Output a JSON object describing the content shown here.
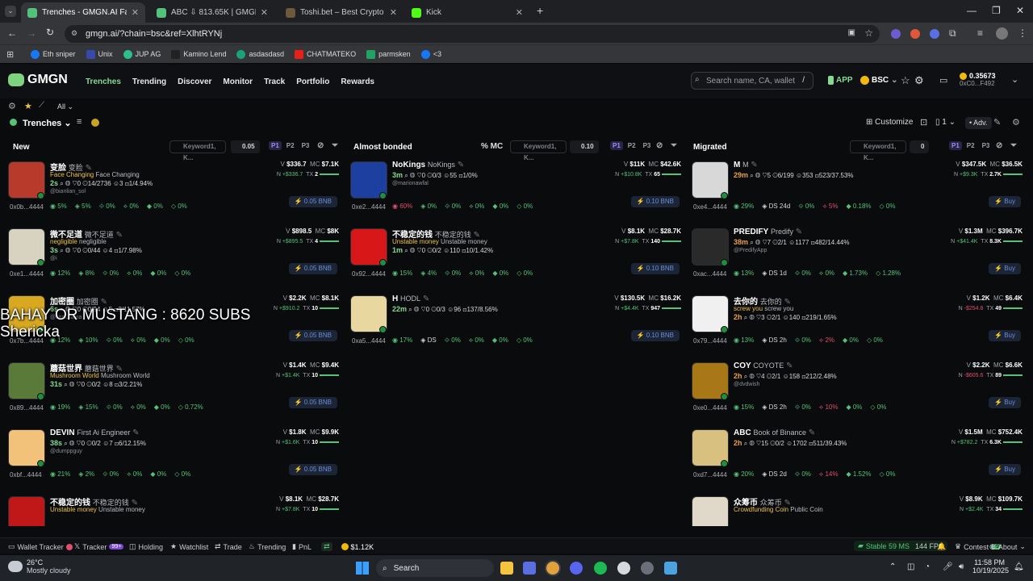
{
  "browser": {
    "tabs": [
      {
        "title": "Trenches - GMGN.AI Fast Trading",
        "active": true
      },
      {
        "title": "ABC ⇩ 813.65K | GMGN.AI Fast",
        "active": false
      },
      {
        "title": "Toshi.bet – Best Crypto Casino",
        "active": false
      },
      {
        "title": "Kick",
        "active": false
      }
    ],
    "url": "gmgn.ai/?chain=bsc&ref=XlhtRYNj",
    "bookmarks": [
      "Eth sniper",
      "Unix",
      "JUP AG",
      "Kamino Lend",
      "asdasdasd",
      "CHATMATEKO",
      "parmsken",
      "<3"
    ]
  },
  "header": {
    "logo": "GMGN",
    "nav": [
      "Trenches",
      "Trending",
      "Discover",
      "Monitor",
      "Track",
      "Portfolio",
      "Rewards"
    ],
    "active_nav": "Trenches",
    "search_placeholder": "Search name, CA, wallet",
    "search_shortcut": "/",
    "app_label": "APP",
    "chain": "BSC",
    "balance": "0.35673",
    "wallet": "0xC0...F492"
  },
  "subbar": {
    "filter": "All",
    "title": "Trenches",
    "customize": "Customize",
    "count": "1",
    "adv": "Adv."
  },
  "columns": [
    {
      "title": "New",
      "keyword": "Keyword1, K...",
      "amount": "0.05",
      "presets": [
        "P1",
        "P2",
        "P3"
      ]
    },
    {
      "title": "Almost bonded",
      "sort": "% MC",
      "keyword": "Keyword1, K...",
      "amount": "0.10",
      "presets": [
        "P1",
        "P2",
        "P3"
      ]
    },
    {
      "title": "Migrated",
      "keyword": "Keyword1, K...",
      "amount": "0",
      "presets": [
        "P1",
        "P2",
        "P3"
      ]
    }
  ],
  "new_tokens": [
    {
      "name": "变脸",
      "sub": "变脸",
      "desc": "Face Changing",
      "desc2": "Face Changing",
      "age": "2s",
      "a": "0",
      "b": "14/2736",
      "c": "3",
      "d": "1/4.94%",
      "handle": "@bianlian_sol",
      "addr": "0x0b...4444",
      "v": "$336.7",
      "mc": "$7.1K",
      "n": "+$336.7",
      "tx": "2",
      "s": [
        "5%",
        "5%",
        "0%",
        "0%",
        "0%",
        "0%"
      ],
      "btn": "0.05 BNB"
    },
    {
      "name": "微不足道",
      "sub": "微不足道",
      "desc": "negligible",
      "desc2": "negligible",
      "age": "3s",
      "a": "0",
      "b": "0/44",
      "c": "4",
      "d": "1/7.98%",
      "handle": "@i",
      "addr": "0xe1...4444",
      "v": "$898.5",
      "mc": "$8K",
      "n": "+$895.5",
      "tx": "4",
      "s": [
        "12%",
        "8%",
        "0%",
        "0%",
        "0%",
        "0%"
      ],
      "btn": "0.05 BNB"
    },
    {
      "name": "加密圈",
      "sub": "加密圈",
      "desc": "",
      "desc2": "",
      "age": "6s",
      "a": "0",
      "b": "0/94",
      "c": "5",
      "d": "3/11.57%",
      "handle": "@JiraLsama",
      "addr": "0x7b...4444",
      "v": "$2.2K",
      "mc": "$8.1K",
      "n": "+$910.2",
      "tx": "10",
      "s": [
        "12%",
        "10%",
        "0%",
        "0%",
        "0%",
        "0%"
      ],
      "btn": "0.05 BNB"
    },
    {
      "name": "蘑菇世界",
      "sub": "蘑菇世界",
      "desc": "Mushroom World",
      "desc2": "Mushroom World",
      "age": "31s",
      "a": "0",
      "b": "0/2",
      "c": "8",
      "d": "3/2.21%",
      "handle": "",
      "addr": "0x89...4444",
      "v": "$1.4K",
      "mc": "$9.4K",
      "n": "+$1.4K",
      "tx": "10",
      "s": [
        "19%",
        "15%",
        "0%",
        "0%",
        "0%",
        "0.72%"
      ],
      "btn": "0.05 BNB"
    },
    {
      "name": "DEVIN",
      "sub": "First Ai Engineer",
      "desc": "",
      "desc2": "",
      "age": "38s",
      "a": "0",
      "b": "0/2",
      "c": "7",
      "d": "6/12.15%",
      "handle": "@dumppguy",
      "addr": "0xbf...4444",
      "v": "$1.8K",
      "mc": "$9.9K",
      "n": "+$1.6K",
      "tx": "10",
      "s": [
        "21%",
        "2%",
        "0%",
        "0%",
        "0%",
        "0%"
      ],
      "btn": "0.05 BNB"
    },
    {
      "name": "不稳定的钱",
      "sub": "不稳定的钱",
      "desc": "Unstable money",
      "desc2": "Unstable money",
      "age": "",
      "a": "",
      "b": "",
      "c": "",
      "d": "",
      "handle": "",
      "addr": "",
      "v": "$8.1K",
      "mc": "$28.7K",
      "n": "+$7.8K",
      "tx": "10",
      "s": [],
      "btn": ""
    }
  ],
  "bonded_tokens": [
    {
      "name": "NoKings",
      "sub": "NoKings",
      "desc": "",
      "desc2": "",
      "age": "3m",
      "a": "0",
      "b": "0/3",
      "c": "55",
      "d": "1/0%",
      "handle": "@marionawfal",
      "addr": "0xe2...4444",
      "v": "$11K",
      "mc": "$42.6K",
      "n": "+$10.8K",
      "tx": "65",
      "s": [
        "60%",
        "0%",
        "0%",
        "0%",
        "0%",
        "0%"
      ],
      "btn": "0.10 BNB"
    },
    {
      "name": "不稳定的钱",
      "sub": "不稳定的钱",
      "desc": "Unstable money",
      "desc2": "Unstable money",
      "age": "1m",
      "a": "0",
      "b": "0/2",
      "c": "110",
      "d": "10/1.42%",
      "handle": "",
      "addr": "0x92...4444",
      "v": "$8.1K",
      "mc": "$28.7K",
      "n": "+$7.8K",
      "tx": "140",
      "s": [
        "15%",
        "4%",
        "0%",
        "0%",
        "0%",
        "0%"
      ],
      "btn": "0.10 BNB"
    },
    {
      "name": "H",
      "sub": "HODL",
      "desc": "",
      "desc2": "",
      "age": "22m",
      "a": "0",
      "b": "0/3",
      "c": "96",
      "d": "137/8.56%",
      "handle": "",
      "addr": "0xa5...4444",
      "v": "$130.5K",
      "mc": "$16.2K",
      "n": "+$4.4K",
      "tx": "947",
      "s": [
        "17%",
        "DS",
        "0%",
        "0%",
        "0%",
        "0%"
      ],
      "btn": "0.10 BNB"
    }
  ],
  "migrated_tokens": [
    {
      "name": "M",
      "sub": "M",
      "desc": "",
      "desc2": "",
      "age": "29m",
      "a": "5",
      "b": "6/199",
      "c": "353",
      "d": "523/37.53%",
      "handle": "",
      "addr": "0xe4...4444",
      "v": "$347.5K",
      "mc": "$36.5K",
      "n": "+$9.3K",
      "tx": "2.7K",
      "s": [
        "29%",
        "DS 24d",
        "0%",
        "5%",
        "0.18%",
        "0%"
      ],
      "btn": "Buy"
    },
    {
      "name": "PREDIFY",
      "sub": "Predify",
      "desc": "",
      "desc2": "",
      "age": "38m",
      "a": "7",
      "b": "2/1",
      "c": "1177",
      "d": "482/14.44%",
      "handle": "@PredifyApp",
      "addr": "0xac...4444",
      "v": "$1.3M",
      "mc": "$396.7K",
      "n": "+$41.4K",
      "tx": "8.3K",
      "s": [
        "13%",
        "DS 1d",
        "0%",
        "0%",
        "1.73%",
        "1.28%"
      ],
      "btn": "Buy"
    },
    {
      "name": "去你的",
      "sub": "去你的",
      "desc": "screw you",
      "desc2": "screw you",
      "age": "2h",
      "a": "3",
      "b": "2/1",
      "c": "140",
      "d": "219/1.65%",
      "handle": "",
      "addr": "0x79...4444",
      "v": "$1.2K",
      "mc": "$6.4K",
      "n": "-$254.8",
      "tx": "49",
      "s": [
        "13%",
        "DS 2h",
        "0%",
        "2%",
        "0%",
        "0%"
      ],
      "btn": "Buy"
    },
    {
      "name": "COY",
      "sub": "COYOTE",
      "desc": "",
      "desc2": "",
      "age": "2h",
      "a": "4",
      "b": "2/1",
      "c": "158",
      "d": "212/2.48%",
      "handle": "@dvdwish",
      "addr": "0xe0...4444",
      "v": "$2.2K",
      "mc": "$6.6K",
      "n": "-$605.6",
      "tx": "89",
      "s": [
        "15%",
        "DS 2h",
        "0%",
        "10%",
        "0%",
        "0%"
      ],
      "btn": "Buy"
    },
    {
      "name": "ABC",
      "sub": "Book of Binance",
      "desc": "",
      "desc2": "",
      "age": "2h",
      "a": "15",
      "b": "0/2",
      "c": "1702",
      "d": "511/39.43%",
      "handle": "",
      "addr": "0xd7...4444",
      "v": "$1.5M",
      "mc": "$752.4K",
      "n": "+$782.2",
      "tx": "6.3K",
      "s": [
        "20%",
        "DS 2d",
        "0%",
        "14%",
        "1.52%",
        "0%"
      ],
      "btn": "Buy"
    },
    {
      "name": "众筹币",
      "sub": "众筹币",
      "desc": "Crowdfunding Coin",
      "desc2": "Public Coin",
      "age": "",
      "a": "",
      "b": "",
      "c": "",
      "d": "",
      "handle": "",
      "addr": "",
      "v": "$8.9K",
      "mc": "$109.7K",
      "n": "+$2.4K",
      "tx": "34",
      "s": [],
      "btn": ""
    }
  ],
  "overlay_text": [
    "BAHAY OR MUSTANG : 8620 SUBS",
    "Shericka"
  ],
  "bottom_bar": {
    "items": [
      "Wallet Tracker",
      "Tracker",
      "Holding",
      "Watchlist",
      "Trade",
      "Trending",
      "PnL"
    ],
    "tracker_badge": "99+",
    "price": "$1.12K",
    "status": "Stable 59 MS",
    "fps": "144 FPS",
    "contest": "Contest",
    "contest_badge": "59",
    "about": "About"
  },
  "taskbar": {
    "temp": "26°C",
    "weather": "Mostly cloudy",
    "search": "Search",
    "time": "11:58 PM",
    "date": "10/19/2025"
  }
}
